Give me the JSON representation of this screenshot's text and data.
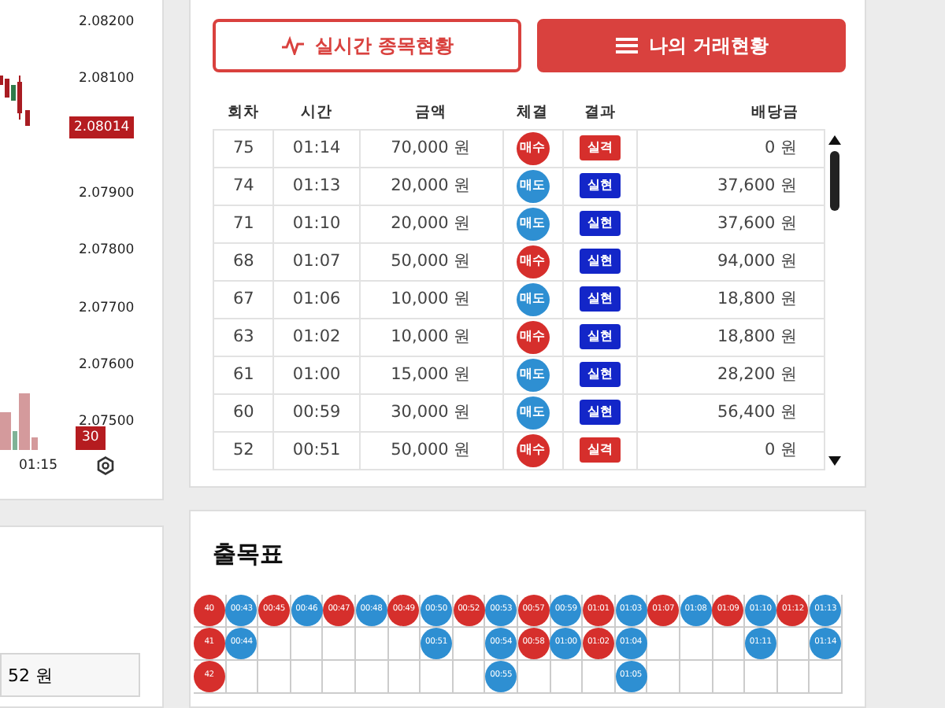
{
  "chart": {
    "price_axis": [
      {
        "text": "2.08200",
        "kind": "tick"
      },
      {
        "text": "2.08100",
        "kind": "tick"
      },
      {
        "text": "2.08014",
        "kind": "current"
      },
      {
        "text": "2.07900",
        "kind": "tick"
      },
      {
        "text": "2.07800",
        "kind": "tick"
      },
      {
        "text": "2.07700",
        "kind": "tick"
      },
      {
        "text": "2.07600",
        "kind": "tick"
      },
      {
        "text": "2.07500",
        "kind": "tick"
      }
    ],
    "volume_tag": "30",
    "time_label": "01:15"
  },
  "balance_field": {
    "value": "52 원"
  },
  "tabs": [
    {
      "label": "실시간 종목현황",
      "selected": false,
      "kind": "wave"
    },
    {
      "label": "나의 거래현황",
      "selected": true,
      "kind": "list"
    }
  ],
  "table": {
    "columns": [
      "회차",
      "시간",
      "금액",
      "체결",
      "결과",
      "배당금"
    ],
    "rows": [
      {
        "round": "75",
        "time": "01:14",
        "amount": "70,000 원",
        "side": {
          "label": "매수",
          "kind": "buy"
        },
        "result": {
          "label": "실격",
          "kind": "lose"
        },
        "payout": "0 원"
      },
      {
        "round": "74",
        "time": "01:13",
        "amount": "20,000 원",
        "side": {
          "label": "매도",
          "kind": "sell"
        },
        "result": {
          "label": "실현",
          "kind": "win"
        },
        "payout": "37,600 원"
      },
      {
        "round": "71",
        "time": "01:10",
        "amount": "20,000 원",
        "side": {
          "label": "매도",
          "kind": "sell"
        },
        "result": {
          "label": "실현",
          "kind": "win"
        },
        "payout": "37,600 원"
      },
      {
        "round": "68",
        "time": "01:07",
        "amount": "50,000 원",
        "side": {
          "label": "매수",
          "kind": "buy"
        },
        "result": {
          "label": "실현",
          "kind": "win"
        },
        "payout": "94,000 원"
      },
      {
        "round": "67",
        "time": "01:06",
        "amount": "10,000 원",
        "side": {
          "label": "매도",
          "kind": "sell"
        },
        "result": {
          "label": "실현",
          "kind": "win"
        },
        "payout": "18,800 원"
      },
      {
        "round": "63",
        "time": "01:02",
        "amount": "10,000 원",
        "side": {
          "label": "매수",
          "kind": "buy"
        },
        "result": {
          "label": "실현",
          "kind": "win"
        },
        "payout": "18,800 원"
      },
      {
        "round": "61",
        "time": "01:00",
        "amount": "15,000 원",
        "side": {
          "label": "매도",
          "kind": "sell"
        },
        "result": {
          "label": "실현",
          "kind": "win"
        },
        "payout": "28,200 원"
      },
      {
        "round": "60",
        "time": "00:59",
        "amount": "30,000 원",
        "side": {
          "label": "매도",
          "kind": "sell"
        },
        "result": {
          "label": "실현",
          "kind": "win"
        },
        "payout": "56,400 원"
      },
      {
        "round": "52",
        "time": "00:51",
        "amount": "50,000 원",
        "side": {
          "label": "매수",
          "kind": "buy"
        },
        "result": {
          "label": "실격",
          "kind": "lose"
        },
        "payout": "0 원"
      }
    ]
  },
  "bead_board": {
    "title": "출목표",
    "columns": [
      {
        "kind": "buy",
        "beads": [
          "40",
          "41",
          "42"
        ]
      },
      {
        "kind": "sell",
        "beads": [
          "00:43",
          "00:44"
        ]
      },
      {
        "kind": "buy",
        "beads": [
          "00:45"
        ]
      },
      {
        "kind": "sell",
        "beads": [
          "00:46"
        ]
      },
      {
        "kind": "buy",
        "beads": [
          "00:47"
        ]
      },
      {
        "kind": "sell",
        "beads": [
          "00:48"
        ]
      },
      {
        "kind": "buy",
        "beads": [
          "00:49"
        ]
      },
      {
        "kind": "sell",
        "beads": [
          "00:50",
          "00:51"
        ]
      },
      {
        "kind": "buy",
        "beads": [
          "00:52"
        ]
      },
      {
        "kind": "sell",
        "beads": [
          "00:53",
          "00:54",
          "00:55"
        ]
      },
      {
        "kind": "buy",
        "beads": [
          "00:57",
          "00:58"
        ]
      },
      {
        "kind": "sell",
        "beads": [
          "00:59",
          "01:00"
        ]
      },
      {
        "kind": "buy",
        "beads": [
          "01:01",
          "01:02"
        ]
      },
      {
        "kind": "sell",
        "beads": [
          "01:03",
          "01:04",
          "01:05"
        ]
      },
      {
        "kind": "buy",
        "beads": [
          "01:07"
        ]
      },
      {
        "kind": "sell",
        "beads": [
          "01:08"
        ]
      },
      {
        "kind": "buy",
        "beads": [
          "01:09"
        ]
      },
      {
        "kind": "sell",
        "beads": [
          "01:10",
          "01:11"
        ]
      },
      {
        "kind": "buy",
        "beads": [
          "01:12"
        ]
      },
      {
        "kind": "sell",
        "beads": [
          "01:13",
          "01:14"
        ]
      }
    ]
  }
}
